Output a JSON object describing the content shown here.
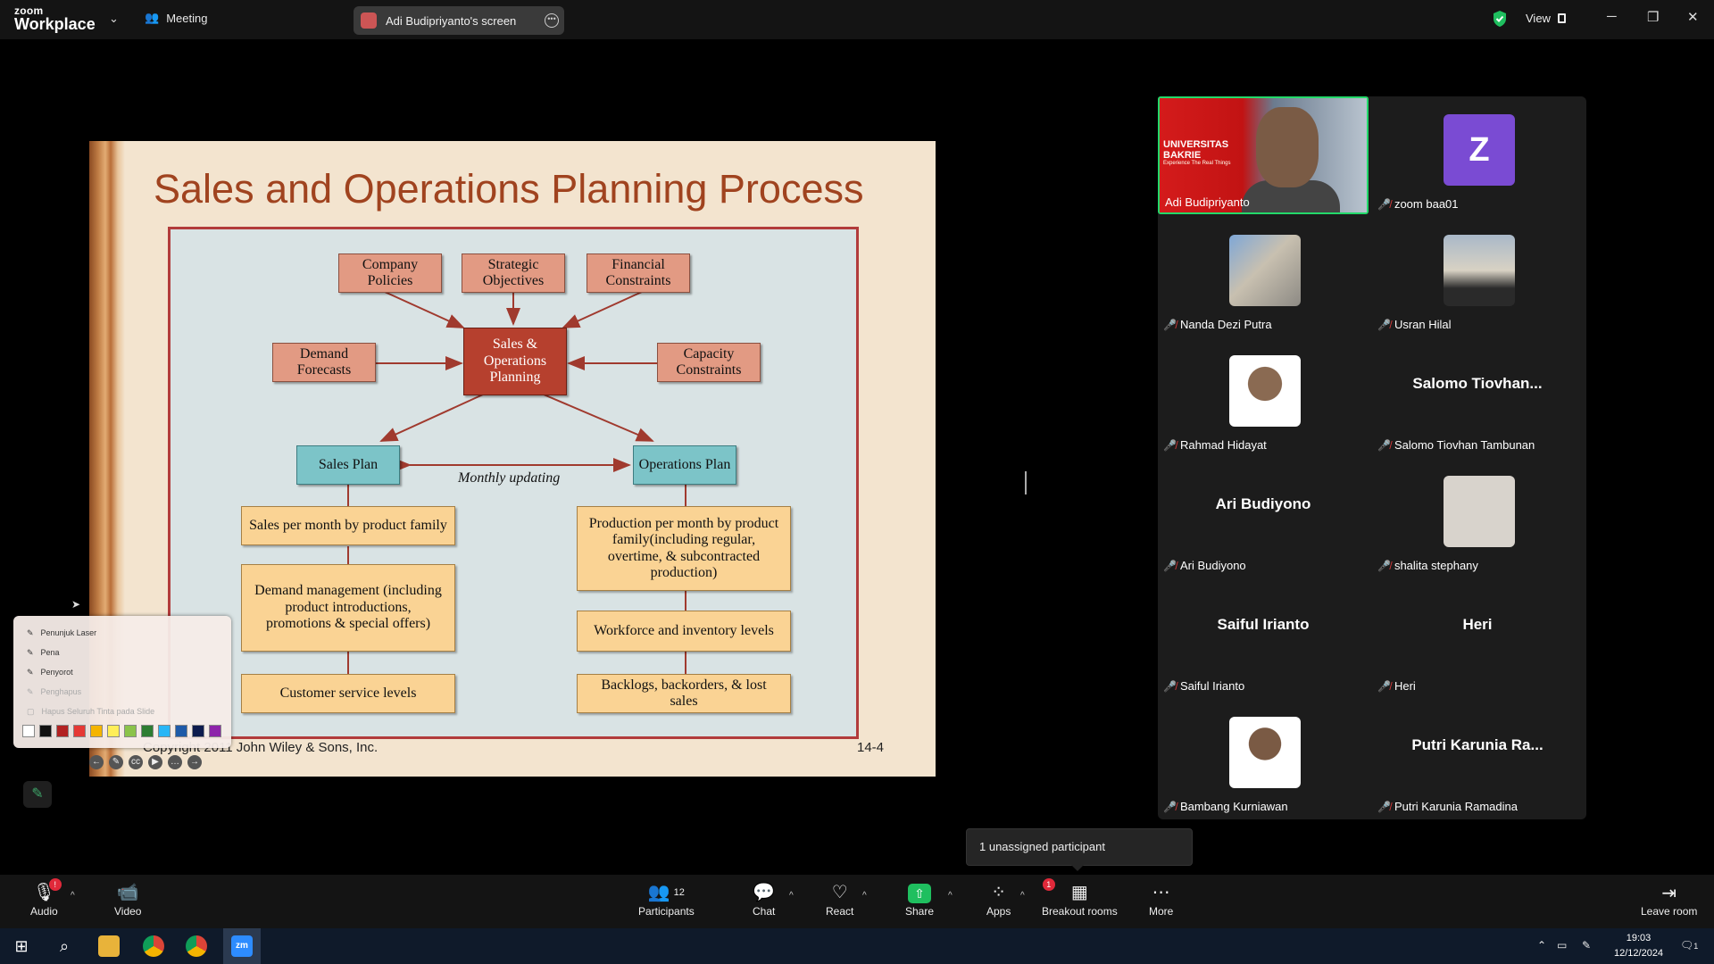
{
  "titlebar": {
    "logo_top": "zoom",
    "logo_bottom": "Workplace",
    "meeting_label": "Meeting",
    "screen_share_label": "Adi Budipriyanto's screen",
    "view_label": "View"
  },
  "slide": {
    "title": "Sales and Operations Planning Process",
    "boxes": {
      "company_policies": "Company Policies",
      "strategic_objectives": "Strategic Objectives",
      "financial_constraints": "Financial Constraints",
      "demand_forecasts": "Demand Forecasts",
      "sop": "Sales & Operations Planning",
      "capacity_constraints": "Capacity Constraints",
      "sales_plan": "Sales Plan",
      "operations_plan": "Operations Plan",
      "sales_per_month": "Sales per month by product family",
      "demand_management": "Demand management (including product introductions, promotions & special offers)",
      "customer_service": "Customer service levels",
      "production_per_month": "Production per month by product family(including regular, overtime, & subcontracted production)",
      "workforce": "Workforce and inventory levels",
      "backlogs": "Backlogs, backorders, & lost sales"
    },
    "monthly_updating": "Monthly updating",
    "copyright": "Copyright 2011 John Wiley & Sons, Inc.",
    "slide_number": "14-4"
  },
  "pen_menu": {
    "items": [
      "Penunjuk Laser",
      "Pena",
      "Penyorot",
      "Penghapus",
      "Hapus Seluruh Tinta pada Slide"
    ],
    "colors": [
      "#ffffff",
      "#111111",
      "#b22222",
      "#e53935",
      "#f4b400",
      "#ffee58",
      "#8bc34a",
      "#2e7d32",
      "#29b6f6",
      "#1e5aa8",
      "#0d1b4d",
      "#8e24aa"
    ]
  },
  "gallery": {
    "presenter": {
      "name": "Adi Budipriyanto",
      "org_line1": "UNIVERSITAS",
      "org_line2": "BAKRIE",
      "tagline": "Experience The Real Things"
    },
    "participants": [
      {
        "name": "zoom baa01",
        "avatar": "Z",
        "display": ""
      },
      {
        "name": "Nanda Dezi Putra",
        "display": ""
      },
      {
        "name": "Usran Hilal",
        "display": ""
      },
      {
        "name": "Rahmad Hidayat",
        "display": ""
      },
      {
        "name": "Salomo Tiovhan Tambunan",
        "display": "Salomo  Tiovhan..."
      },
      {
        "name": "Ari Budiyono",
        "display": "Ari Budiyono"
      },
      {
        "name": "shalita stephany",
        "display": ""
      },
      {
        "name": "Saiful Irianto",
        "display": "Saiful Irianto"
      },
      {
        "name": "Heri",
        "display": "Heri"
      },
      {
        "name": "Bambang Kurniawan",
        "display": ""
      },
      {
        "name": "Putri Karunia Ramadina",
        "display": "Putri Karunia  Ra..."
      }
    ]
  },
  "popup": {
    "text": "1 unassigned participant"
  },
  "toolbar": {
    "audio": "Audio",
    "video": "Video",
    "participants": "Participants",
    "participants_count": "12",
    "chat": "Chat",
    "react": "React",
    "share": "Share",
    "apps": "Apps",
    "breakout": "Breakout rooms",
    "breakout_badge": "1",
    "more": "More",
    "leave": "Leave room"
  },
  "taskbar": {
    "time": "19:03",
    "date": "12/12/2024",
    "notifications": "1"
  },
  "colors": {
    "accent_green": "#23d96a",
    "slide_title": "#a0431f",
    "badge_red": "#e0293a"
  }
}
